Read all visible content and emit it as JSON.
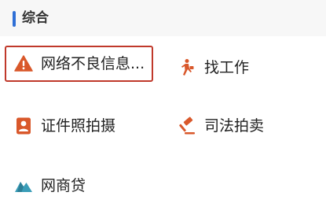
{
  "section": {
    "title": "综合",
    "accent_color": "#2f6fd6"
  },
  "items": [
    {
      "label": "网络不良信息...",
      "icon": "warning-triangle-icon",
      "icon_color": "#d9582b",
      "selected": true
    },
    {
      "label": "找工作",
      "icon": "walking-person-icon",
      "icon_color": "#d9582b"
    },
    {
      "label": "证件照拍摄",
      "icon": "id-photo-icon",
      "icon_color": "#d9582b"
    },
    {
      "label": "司法拍卖",
      "icon": "gavel-icon",
      "icon_color": "#d9582b"
    },
    {
      "label": "网商贷",
      "icon": "mountain-logo-icon",
      "icon_color": "#3a9db8"
    }
  ],
  "highlight_color": "#c0392b"
}
